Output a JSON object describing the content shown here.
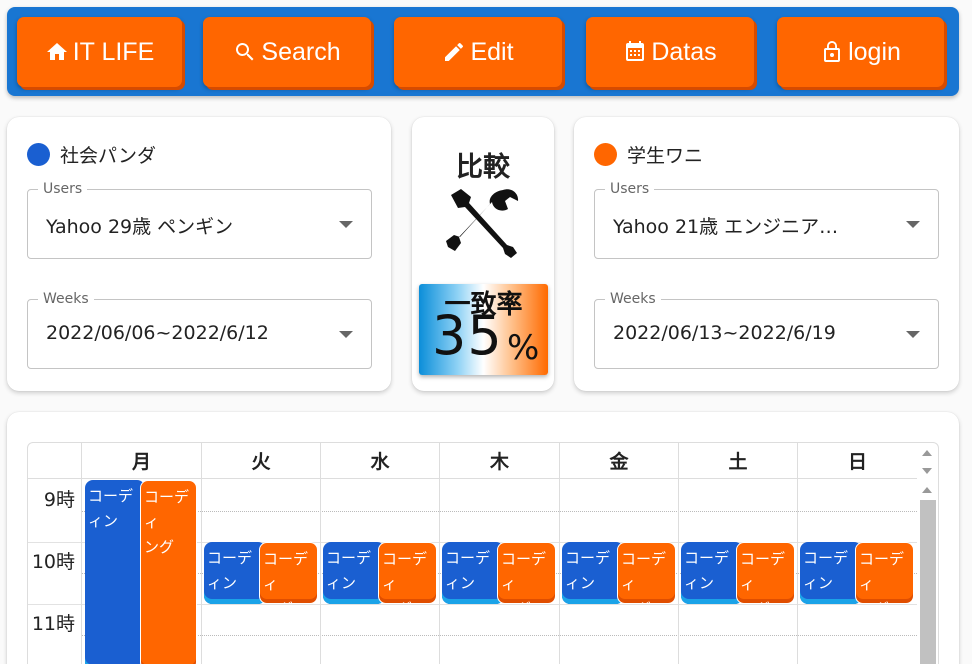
{
  "nav": {
    "items": [
      {
        "label": "IT LIFE",
        "icon": "home-icon"
      },
      {
        "label": "Search",
        "icon": "search-icon"
      },
      {
        "label": "Edit",
        "icon": "pencil-icon"
      },
      {
        "label": "Datas",
        "icon": "calendar-icon"
      },
      {
        "label": "login",
        "icon": "lock-icon"
      }
    ]
  },
  "left": {
    "name": "社会パンダ",
    "color": "#1a5fd1",
    "users_label": "Users",
    "users_value": "Yahoo 29歳 ペンギン",
    "weeks_label": "Weeks",
    "weeks_value": "2022/06/06~2022/6/12"
  },
  "compare": {
    "title": "比較",
    "icon": "tools-icon",
    "match_label": "一致率",
    "match_value": "35",
    "match_unit": "%"
  },
  "right": {
    "name": "学生ワニ",
    "color": "#ff6600",
    "users_label": "Users",
    "users_value": "Yahoo 21歳 エンジニア…",
    "weeks_label": "Weeks",
    "weeks_value": "2022/06/13~2022/6/19"
  },
  "calendar": {
    "days": [
      "月",
      "火",
      "水",
      "木",
      "金",
      "土",
      "日"
    ],
    "times": [
      "9時",
      "10時",
      "11時"
    ],
    "event_title": "コーディング",
    "blue_label": "コーディン",
    "orange_label": "コーディ\nング"
  }
}
